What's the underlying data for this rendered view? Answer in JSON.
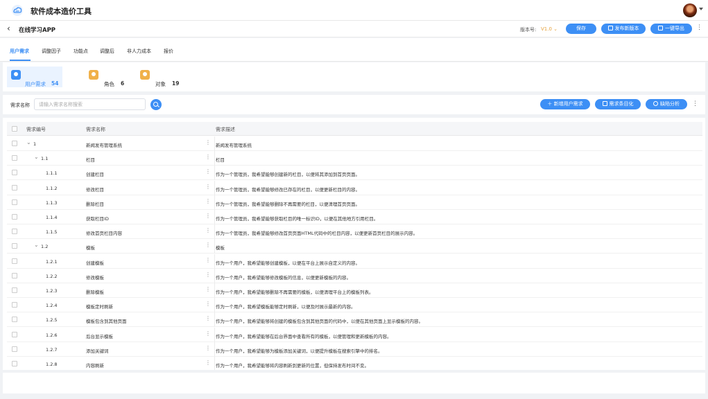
{
  "header": {
    "app_title": "软件成本造价工具",
    "logo_icon": "cloud-logo-icon"
  },
  "subheader": {
    "project_title": "在线学习APP",
    "version_label": "版本号:",
    "version_value": "V1.0",
    "buttons": {
      "save": "保存",
      "publish": "发布新版本",
      "export": "一键导出"
    }
  },
  "tabs": [
    "用户需求",
    "调整因子",
    "功能点",
    "调整后",
    "非人力成本",
    "报价"
  ],
  "stats": [
    {
      "label": "用户需求",
      "count": "54",
      "color": "#3d8ff5"
    },
    {
      "label": "角色",
      "count": "6",
      "color": "#f0b14a"
    },
    {
      "label": "对象",
      "count": "19",
      "color": "#f0b14a"
    }
  ],
  "toolbar": {
    "search_label": "需求名称",
    "search_placeholder": "请输入需求名称搜索",
    "btn_new": "新增用户需求",
    "btn_list": "需求条目化",
    "btn_analysis": "缺陷分析"
  },
  "table": {
    "columns": [
      "需求编号",
      "需求名称",
      "需求描述"
    ],
    "rows": [
      {
        "id": "1",
        "level": 0,
        "expand": true,
        "name": "新闻发布管理系统",
        "desc": "新闻发布管理系统"
      },
      {
        "id": "1.1",
        "level": 1,
        "expand": true,
        "name": "栏目",
        "desc": "栏目"
      },
      {
        "id": "1.1.1",
        "level": 2,
        "expand": false,
        "name": "创建栏目",
        "desc": "作为一个管理员，我希望能够创建新的栏目，以便将其添加到首页页面。"
      },
      {
        "id": "1.1.2",
        "level": 2,
        "expand": false,
        "name": "修改栏目",
        "desc": "作为一个管理员，我希望能够修改已存在的栏目，以便更新栏目的内容。"
      },
      {
        "id": "1.1.3",
        "level": 2,
        "expand": false,
        "name": "删除栏目",
        "desc": "作为一个管理员，我希望能够删除不再需要的栏目，以便清理首页页面。"
      },
      {
        "id": "1.1.4",
        "level": 2,
        "expand": false,
        "name": "获取栏目ID",
        "desc": "作为一个管理员，我希望能够获取栏目的唯一标识ID，以便在其他地方引用栏目。"
      },
      {
        "id": "1.1.5",
        "level": 2,
        "expand": false,
        "name": "修改首页栏目内容",
        "desc": "作为一个管理员，我希望能够修改首页页面HTML代码中的栏目内容，以便更新首页栏目的展示内容。"
      },
      {
        "id": "1.2",
        "level": 1,
        "expand": true,
        "name": "模板",
        "desc": "模板"
      },
      {
        "id": "1.2.1",
        "level": 2,
        "expand": false,
        "name": "创建模板",
        "desc": "作为一个用户，我希望能够创建模板，以便在平台上展示自定义的内容。"
      },
      {
        "id": "1.2.2",
        "level": 2,
        "expand": false,
        "name": "修改模板",
        "desc": "作为一个用户，我希望能够修改模板的信息，以便更新模板的内容。"
      },
      {
        "id": "1.2.3",
        "level": 2,
        "expand": false,
        "name": "删除模板",
        "desc": "作为一个用户，我希望能够删除不再需要的模板，以便清理平台上的模板列表。"
      },
      {
        "id": "1.2.4",
        "level": 2,
        "expand": false,
        "name": "模板定时刷新",
        "desc": "作为一个用户，我希望模板能够定时刷新，以便及时展示最新的内容。"
      },
      {
        "id": "1.2.5",
        "level": 2,
        "expand": false,
        "name": "模板包含到其他页面",
        "desc": "作为一个用户，我希望能够将创建的模板包含到其他页面的代码中，以便在其他页面上显示模板的内容。"
      },
      {
        "id": "1.2.6",
        "level": 2,
        "expand": false,
        "name": "后台显示模板",
        "desc": "作为一个用户，我希望能够在后台界面中查看所有的模板，以便管理和更新模板的内容。"
      },
      {
        "id": "1.2.7",
        "level": 2,
        "expand": false,
        "name": "添加关键词",
        "desc": "作为一个用户，我希望能够为模板添加关键词，以便提升模板在搜索引擎中的排名。"
      },
      {
        "id": "1.2.8",
        "level": 2,
        "expand": false,
        "name": "内容刷新",
        "desc": "作为一个用户，我希望能够将内容刷新到更新的位置，但保持发布时间不变。"
      }
    ]
  }
}
